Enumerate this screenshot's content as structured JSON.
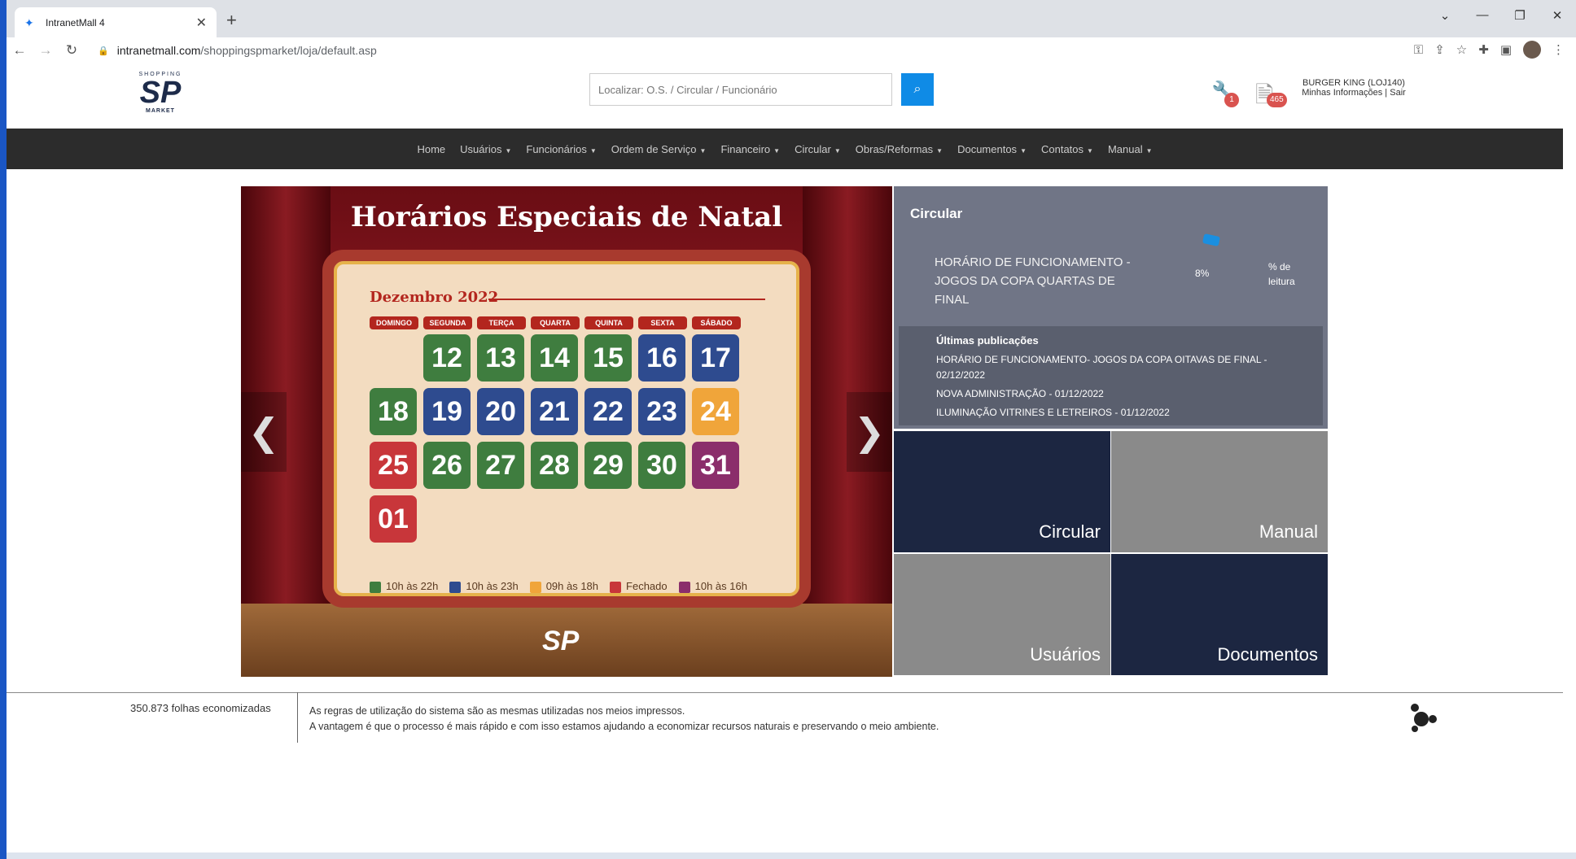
{
  "browser": {
    "tab_title": "IntranetMall 4",
    "url_domain": "intranetmall.com",
    "url_path": "/shoppingspmarket/loja/default.asp"
  },
  "header": {
    "logo_top": "SHOPPING",
    "logo_main": "SP",
    "logo_bottom": "MARKET",
    "search_placeholder": "Localizar: O.S. / Circular / Funcionário",
    "wrench_badge": "1",
    "doc_badge": "465",
    "user_name": "BURGER KING (LOJ140)",
    "user_info_link": "Minhas Informações",
    "user_sep": " | ",
    "user_logout": "Sair"
  },
  "menu": {
    "items": [
      {
        "label": "Home",
        "dropdown": false
      },
      {
        "label": "Usuários",
        "dropdown": true
      },
      {
        "label": "Funcionários",
        "dropdown": true
      },
      {
        "label": "Ordem de Serviço",
        "dropdown": true
      },
      {
        "label": "Financeiro",
        "dropdown": true
      },
      {
        "label": "Circular",
        "dropdown": true
      },
      {
        "label": "Obras/Reformas",
        "dropdown": true
      },
      {
        "label": "Documentos",
        "dropdown": true
      },
      {
        "label": "Contatos",
        "dropdown": true
      },
      {
        "label": "Manual",
        "dropdown": true
      }
    ]
  },
  "carousel": {
    "title": "Horários Especiais de Natal",
    "month": "Dezembro 2022",
    "weekdays": [
      "DOMINGO",
      "SEGUNDA",
      "TERÇA",
      "QUARTA",
      "QUINTA",
      "SEXTA",
      "SÁBADO"
    ],
    "legend": [
      {
        "label": "10h às 22h",
        "color": "#3f7d3f"
      },
      {
        "label": "10h às 23h",
        "color": "#2e4b8f"
      },
      {
        "label": "09h às 18h",
        "color": "#f0a53a"
      },
      {
        "label": "Fechado",
        "color": "#c8363a"
      },
      {
        "label": "10h às 16h",
        "color": "#8b2e6b"
      }
    ],
    "days": [
      {
        "d": "12",
        "color": "#3f7d3f"
      },
      {
        "d": "13",
        "color": "#3f7d3f"
      },
      {
        "d": "14",
        "color": "#3f7d3f"
      },
      {
        "d": "15",
        "color": "#3f7d3f"
      },
      {
        "d": "16",
        "color": "#2e4b8f"
      },
      {
        "d": "17",
        "color": "#2e4b8f"
      },
      {
        "d": "18",
        "color": "#3f7d3f"
      },
      {
        "d": "19",
        "color": "#2e4b8f"
      },
      {
        "d": "20",
        "color": "#2e4b8f"
      },
      {
        "d": "21",
        "color": "#2e4b8f"
      },
      {
        "d": "22",
        "color": "#2e4b8f"
      },
      {
        "d": "23",
        "color": "#2e4b8f"
      },
      {
        "d": "24",
        "color": "#f0a53a"
      },
      {
        "d": "25",
        "color": "#c8363a"
      },
      {
        "d": "26",
        "color": "#3f7d3f"
      },
      {
        "d": "27",
        "color": "#3f7d3f"
      },
      {
        "d": "28",
        "color": "#3f7d3f"
      },
      {
        "d": "29",
        "color": "#3f7d3f"
      },
      {
        "d": "30",
        "color": "#3f7d3f"
      },
      {
        "d": "31",
        "color": "#8b2e6b"
      },
      {
        "d": "01",
        "color": "#c8363a"
      }
    ],
    "prev_label": "❮",
    "next_label": "❯",
    "bottom_logo": "SP"
  },
  "circular": {
    "heading": "Circular",
    "title": "HORÁRIO DE FUNCIONAMENTO - JOGOS DA COPA QUARTAS DE FINAL",
    "percent": "8%",
    "percent_label": "% de leitura",
    "latest_heading": "Últimas publicações",
    "latest": [
      "HORÁRIO DE FUNCIONAMENTO- JOGOS DA COPA OITAVAS DE FINAL - 02/12/2022",
      "NOVA ADMINISTRAÇÃO - 01/12/2022",
      "ILUMINAÇÃO VITRINES E LETREIROS - 01/12/2022"
    ]
  },
  "tiles": {
    "circular": "Circular",
    "manual": "Manual",
    "usuarios": "Usuários",
    "documentos": "Documentos"
  },
  "footer": {
    "saved": "350.873 folhas economizadas",
    "line1": "As regras de utilização do sistema são as mesmas utilizadas nos meios impressos.",
    "line2": "A vantagem é que o processo é mais rápido e com isso estamos ajudando a economizar recursos naturais e preservando o meio ambiente."
  }
}
